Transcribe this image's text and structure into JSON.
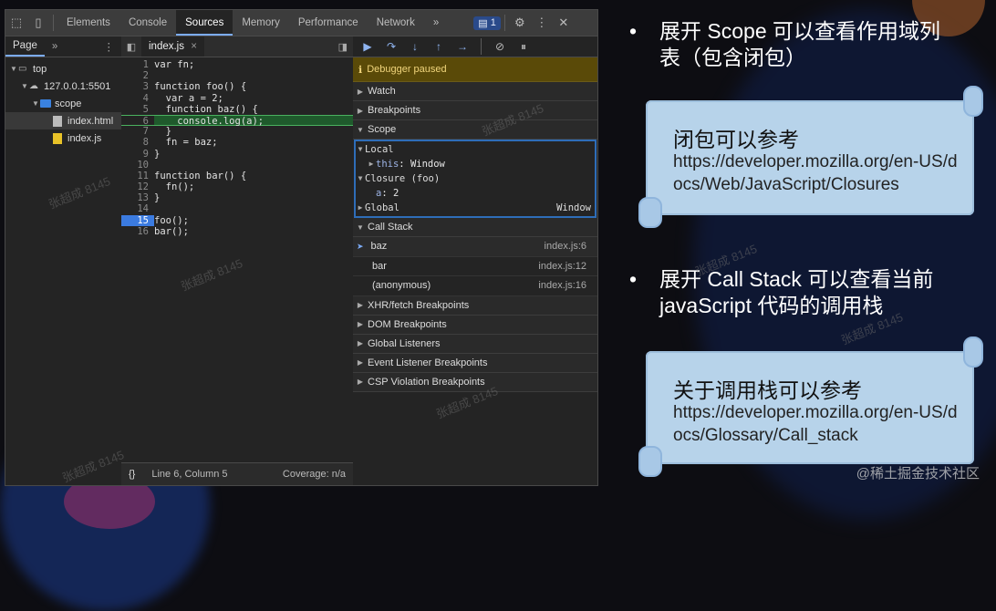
{
  "devtools": {
    "tabs": [
      "Elements",
      "Console",
      "Sources",
      "Memory",
      "Performance",
      "Network"
    ],
    "active_tab": "Sources",
    "more_tabs_icon": "»",
    "issues_count": "1",
    "navigator": {
      "tab_label": "Page",
      "more_icon": "»",
      "tree": [
        {
          "label": "top",
          "depth": 0,
          "icon": "frame-icon"
        },
        {
          "label": "127.0.0.1:5501",
          "depth": 1,
          "icon": "cloud-icon"
        },
        {
          "label": "scope",
          "depth": 2,
          "icon": "folder-icon"
        },
        {
          "label": "index.html",
          "depth": 3,
          "icon": "html-file-icon"
        },
        {
          "label": "index.js",
          "depth": 3,
          "icon": "js-file-icon"
        }
      ]
    },
    "editor": {
      "file_tab": "index.js",
      "lines": [
        {
          "n": "1",
          "code": "var fn;"
        },
        {
          "n": "2",
          "code": ""
        },
        {
          "n": "3",
          "code": "function foo() {"
        },
        {
          "n": "4",
          "code": "  var a = 2;"
        },
        {
          "n": "5",
          "code": "  function baz() {"
        },
        {
          "n": "6",
          "code": "    console.log(a);"
        },
        {
          "n": "7",
          "code": "  }"
        },
        {
          "n": "8",
          "code": "  fn = baz;"
        },
        {
          "n": "9",
          "code": "}"
        },
        {
          "n": "10",
          "code": ""
        },
        {
          "n": "11",
          "code": "function bar() {"
        },
        {
          "n": "12",
          "code": "  fn();"
        },
        {
          "n": "13",
          "code": "}"
        },
        {
          "n": "14",
          "code": ""
        },
        {
          "n": "15",
          "code": "foo();"
        },
        {
          "n": "16",
          "code": "bar();"
        }
      ],
      "current_line": "6",
      "breakpoint_line": "15",
      "status": {
        "braces": "{}",
        "position": "Line 6, Column 5",
        "coverage": "Coverage: n/a"
      }
    },
    "debugger": {
      "paused_banner": "Debugger paused",
      "sections": {
        "watch": "Watch",
        "breakpoints": "Breakpoints",
        "scope": "Scope",
        "call_stack": "Call Stack",
        "xhr": "XHR/fetch Breakpoints",
        "dom": "DOM Breakpoints",
        "global_listeners": "Global Listeners",
        "event_listener": "Event Listener Breakpoints",
        "csp": "CSP Violation Breakpoints"
      },
      "scope": {
        "local_label": "Local",
        "this_key": "this",
        "this_val": "Window",
        "closure_label": "Closure (foo)",
        "a_key": "a",
        "a_val": "2",
        "global_label": "Global",
        "global_val": "Window"
      },
      "call_stack": [
        {
          "fn": "baz",
          "loc": "index.js:6"
        },
        {
          "fn": "bar",
          "loc": "index.js:12"
        },
        {
          "fn": "(anonymous)",
          "loc": "index.js:16"
        }
      ]
    }
  },
  "slide": {
    "bullet1": "展开 Scope 可以查看作用域列表（包含闭包）",
    "note1_title": "闭包可以参考",
    "note1_url": "https://developer.mozilla.org/en-US/docs/Web/JavaScript/Closures",
    "bullet2": "展开 Call Stack 可以查看当前 javaScript 代码的调用栈",
    "note2_title": "关于调用栈可以参考",
    "note2_url": "https://developer.mozilla.org/en-US/docs/Glossary/Call_stack",
    "watermark": "@稀土掘金技术社区",
    "faint_watermark": "张超成 8145"
  }
}
